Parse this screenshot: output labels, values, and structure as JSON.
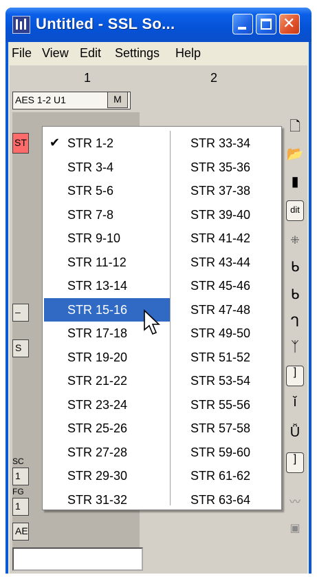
{
  "window": {
    "title": "Untitled - SSL So...",
    "controls": [
      "minimize",
      "maximize",
      "close"
    ]
  },
  "menubar": [
    "File",
    "View",
    "Edit",
    "Settings",
    "Help"
  ],
  "columns": [
    "1",
    "2"
  ],
  "strip": {
    "input_label": "AES 1-2 U1",
    "m_button": "M",
    "red_button": "ST",
    "boxes": [
      "–",
      "S",
      "1",
      "1",
      "AE"
    ],
    "labels": [
      "SC",
      "FG"
    ]
  },
  "toolbar": {
    "icons": [
      "new-document-icon",
      "open-folder-icon",
      "save-icon",
      "edit-icon",
      "route-icon",
      "insert-icon",
      "insert-icon",
      "insert-icon",
      "insert-icon",
      "bracket-icon",
      "marker-icon",
      "bracket-icon",
      "marker-icon",
      "wave-icon",
      "camera-icon"
    ],
    "edit_label": "dit"
  },
  "dropdown": {
    "column1": [
      "STR 1-2",
      "STR 3-4",
      "STR 5-6",
      "STR 7-8",
      "STR 9-10",
      "STR 11-12",
      "STR 13-14",
      "STR 15-16",
      "STR 17-18",
      "STR 19-20",
      "STR 21-22",
      "STR 23-24",
      "STR 25-26",
      "STR 27-28",
      "STR 29-30",
      "STR 31-32"
    ],
    "column2": [
      "STR 33-34",
      "STR 35-36",
      "STR 37-38",
      "STR 39-40",
      "STR 41-42",
      "STR 43-44",
      "STR 45-46",
      "STR 47-48",
      "STR 49-50",
      "STR 51-52",
      "STR 53-54",
      "STR 55-56",
      "STR 57-58",
      "STR 59-60",
      "STR 61-62",
      "STR 63-64"
    ],
    "checked": "STR 1-2",
    "highlighted": "STR 15-16",
    "highlight_color": "#316ac5"
  },
  "colors": {
    "titlebar": "#0552d6",
    "face": "#d4d0c8",
    "red_button": "#ff6b6b"
  }
}
